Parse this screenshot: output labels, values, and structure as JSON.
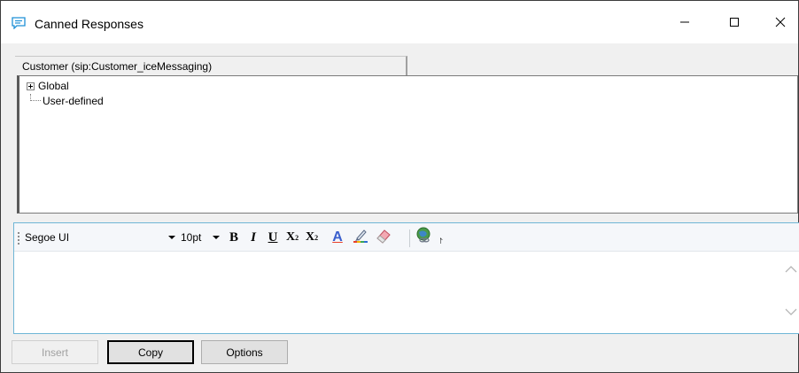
{
  "window": {
    "title": "Canned Responses",
    "icon": "chat-bubble-icon",
    "controls": {
      "minimize": "minimize-icon",
      "maximize": "maximize-icon",
      "close": "close-icon"
    }
  },
  "tab": {
    "label": "Customer (sip:Customer_iceMessaging)"
  },
  "tree": {
    "items": [
      {
        "label": "Global",
        "expandable": true
      },
      {
        "label": "User-defined",
        "expandable": false
      }
    ]
  },
  "toolbar": {
    "font_name": "Segoe UI",
    "font_size": "10pt",
    "bold": "B",
    "italic": "I",
    "underline": "U",
    "subscript": "X",
    "subscript_mark": "2",
    "superscript": "X",
    "superscript_mark": "2",
    "font_color": "A",
    "overflow": "⨡"
  },
  "buttons": {
    "insert": "Insert",
    "copy": "Copy",
    "options": "Options"
  },
  "colors": {
    "accent": "#3a96dd",
    "editor_border": "#6fb6d6"
  }
}
